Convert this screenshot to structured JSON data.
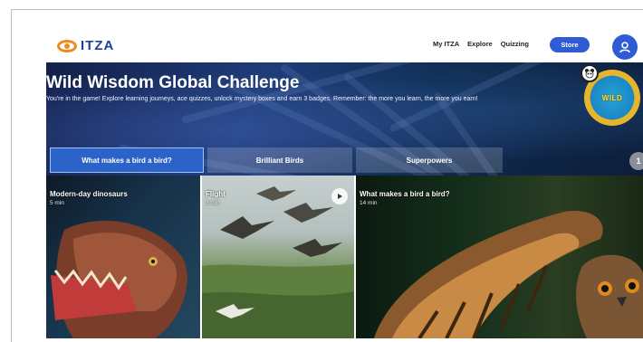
{
  "header": {
    "logo_text": "ITZA",
    "nav": [
      {
        "label": "My ITZA"
      },
      {
        "label": "Explore"
      },
      {
        "label": "Quizzing"
      }
    ],
    "store_label": "Store"
  },
  "hero": {
    "title": "Wild Wisdom Global Challenge",
    "description": "You're in the game! Explore learning journeys, ace quizzes, unlock mystery boxes and earn 3 badges. Remember: the more you learn, the more you earn!",
    "badge_text": "WILD"
  },
  "tabs": [
    {
      "label": "What makes a bird a bird?",
      "active": true
    },
    {
      "label": "Brilliant Birds",
      "active": false
    },
    {
      "label": "Superpowers",
      "active": false
    }
  ],
  "counter": "1",
  "cards": [
    {
      "title": "Modern-day dinosaurs",
      "duration": "5 min"
    },
    {
      "title": "Flight",
      "duration": "3 min"
    },
    {
      "title": "What makes a bird a bird?",
      "duration": "14 min"
    }
  ],
  "colors": {
    "accent": "#2f5bd4",
    "logo_orange": "#f08a1c",
    "logo_blue": "#1f3f9a",
    "hero_bg": "#1f3d7a",
    "active_tab": "#2c63c8"
  },
  "icons": {
    "logo": "eye-logo-icon",
    "profile": "user-icon",
    "play": "play-icon",
    "panda": "panda-icon"
  }
}
